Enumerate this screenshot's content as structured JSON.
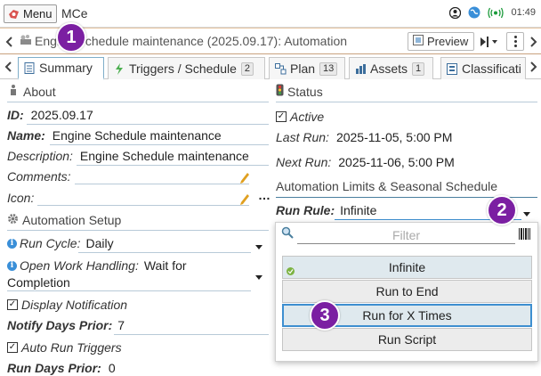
{
  "appbar": {
    "menu_label": "Menu",
    "app_name": "MCe",
    "clock": "01:49"
  },
  "titlebar": {
    "title": "Engine Schedule maintenance (2025.09.17): Automation",
    "preview_label": "Preview"
  },
  "tabs": [
    {
      "label": "Summary",
      "badge": "",
      "active": true
    },
    {
      "label": "Triggers / Schedule",
      "badge": "2",
      "active": false
    },
    {
      "label": "Plan",
      "badge": "13",
      "active": false
    },
    {
      "label": "Assets",
      "badge": "1",
      "active": false
    },
    {
      "label": "Classificati",
      "badge": "",
      "active": false
    }
  ],
  "about": {
    "heading": "About",
    "id_label": "ID:",
    "id_value": "2025.09.17",
    "name_label": "Name:",
    "name_value": "Engine Schedule maintenance",
    "description_label": "Description:",
    "description_value": "Engine Schedule maintenance",
    "comments_label": "Comments:",
    "icon_label": "Icon:"
  },
  "automation_setup": {
    "heading": "Automation Setup",
    "run_cycle_label": "Run Cycle:",
    "run_cycle_value": "Daily",
    "open_work_label": "Open Work Handling:",
    "open_work_value_line1": "Wait for",
    "open_work_value_line2": "Completion",
    "display_notification_label": "Display Notification",
    "notify_days_label": "Notify Days Prior:",
    "notify_days_value": "7",
    "auto_run_label": "Auto Run Triggers",
    "run_days_label": "Run Days Prior:",
    "run_days_value": "0"
  },
  "status": {
    "heading": "Status",
    "active_label": "Active",
    "last_run_label": "Last Run:",
    "last_run_value": "2025-11-05, 5:00 PM",
    "next_run_label": "Next Run:",
    "next_run_value": "2025-11-06, 5:00 PM",
    "limits_heading": "Automation Limits & Seasonal Schedule",
    "run_rule_label": "Run Rule:",
    "run_rule_value": "Infinite"
  },
  "dropdown": {
    "filter_placeholder": "Filter",
    "options": [
      "Infinite",
      "Run to End",
      "Run for X Times",
      "Run Script"
    ]
  },
  "markers": [
    "1",
    "2",
    "3"
  ],
  "colors": {
    "accent_blue": "#3e8fd0",
    "marker_purple": "#7b1fa2",
    "title_border": "#c9a27e"
  }
}
